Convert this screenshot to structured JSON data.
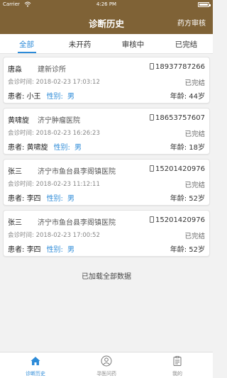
{
  "status_bar": {
    "carrier": "Carrier",
    "time": "4:26 PM"
  },
  "nav": {
    "title": "诊断历史",
    "right_action": "药方审核"
  },
  "tabs": [
    {
      "label": "全部",
      "active": true
    },
    {
      "label": "未开药",
      "active": false
    },
    {
      "label": "审核中",
      "active": false
    },
    {
      "label": "已完结",
      "active": false
    }
  ],
  "records": [
    {
      "doctor": "唐淼",
      "hospital": "建新诊所",
      "phone": "18937787266",
      "consult_label": "会诊时间:",
      "consult_time": "2018-02-23 17:03:12",
      "status": "已完结",
      "patient_label": "患者:",
      "patient_name": "小王",
      "gender_label": "性别:",
      "gender": "男",
      "age_label": "年龄:",
      "age": "44岁"
    },
    {
      "doctor": "黄啸旋",
      "hospital": "济宁肿瘤医院",
      "phone": "18653757607",
      "consult_label": "会诊时间:",
      "consult_time": "2018-02-23 16:26:23",
      "status": "已完结",
      "patient_label": "患者:",
      "patient_name": "黄啸旋",
      "gender_label": "性别:",
      "gender": "男",
      "age_label": "年龄:",
      "age": "18岁"
    },
    {
      "doctor": "张三",
      "hospital": "济宁市鱼台县李阁镇医院",
      "phone": "15201420976",
      "consult_label": "会诊时间:",
      "consult_time": "2018-02-23 11:12:11",
      "status": "已完结",
      "patient_label": "患者:",
      "patient_name": "李四",
      "gender_label": "性别:",
      "gender": "男",
      "age_label": "年龄:",
      "age": "52岁"
    },
    {
      "doctor": "张三",
      "hospital": "济宁市鱼台县李阁镇医院",
      "phone": "15201420976",
      "consult_label": "会诊时间:",
      "consult_time": "2018-02-23 17:00:52",
      "status": "已完结",
      "patient_label": "患者:",
      "patient_name": "李四",
      "gender_label": "性别:",
      "gender": "男",
      "age_label": "年龄:",
      "age": "52岁"
    }
  ],
  "list_footer": "已加载全部数据",
  "tab_bar": [
    {
      "label": "诊断历史",
      "icon": "home-icon",
      "active": true
    },
    {
      "label": "寻医问药",
      "icon": "user-icon",
      "active": false
    },
    {
      "label": "我的",
      "icon": "clipboard-icon",
      "active": false
    }
  ],
  "colors": {
    "header": "#7f6236",
    "accent": "#2d8bd8"
  }
}
